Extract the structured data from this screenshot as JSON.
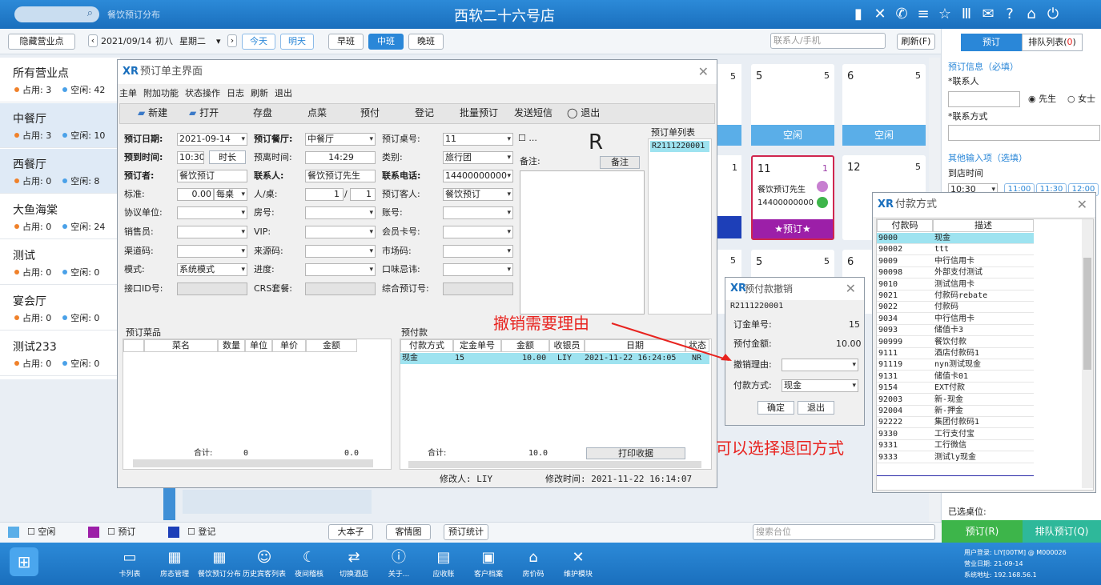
{
  "top": {
    "search_sub": "餐饮预订分布",
    "store": "西软二十六号店"
  },
  "toolbar": {
    "hide": "隐藏营业点",
    "date": "2021/09/14",
    "lunar": "初八",
    "weekday": "星期二",
    "today": "今天",
    "tomorrow": "明天",
    "shift_morning": "早班",
    "shift_mid": "中班",
    "shift_night": "晚班",
    "search_ph": "联系人/手机",
    "refresh": "刷新(F)"
  },
  "outlets": [
    {
      "name": "所有营业点",
      "used": "占用: 3",
      "free": "空闲: 42"
    },
    {
      "name": "中餐厅",
      "used": "占用: 3",
      "free": "空闲: 10"
    },
    {
      "name": "西餐厅",
      "used": "占用: 0",
      "free": "空闲: 8"
    },
    {
      "name": "大鱼海棠",
      "used": "占用: 0",
      "free": "空闲: 24"
    },
    {
      "name": "测试",
      "used": "占用: 0",
      "free": "空闲: 0"
    },
    {
      "name": "宴会厅",
      "used": "占用: 0",
      "free": "空闲: 0"
    },
    {
      "name": "测试233",
      "used": "占用: 0",
      "free": "空闲: 0"
    }
  ],
  "tables": {
    "t5": "5",
    "t5c": "5",
    "t6": "6",
    "t6c": "5",
    "free": "空闲",
    "t11": "11",
    "t11c": "1",
    "guest": "餐饮预订先生",
    "phone": "14400000000",
    "booked": "★预订★",
    "t12": "12",
    "t12c": "5",
    "left1": "5",
    "left2": "1",
    "left3": "5",
    "b5": "5",
    "b5c": "5",
    "b6": "6"
  },
  "right": {
    "tab_book": "预订",
    "tab_queue": "排队列表(",
    "queue_n": "0",
    "queue_end": ")",
    "info": "预订信息（必填）",
    "contact": "*联系人",
    "mr": "先生",
    "ms": "女士",
    "method": "*联系方式",
    "other": "其他输入项（选填）",
    "arrive": "到店时间",
    "arrive_val": "10:30",
    "s1": "11:00",
    "s2": "11:30",
    "s3": "12:00",
    "chosen": "已选桌位:",
    "book_btn": "预订(R)",
    "queue_btn": "排队预订(Q)"
  },
  "legend": {
    "free": "空闲",
    "book": "预订",
    "reg": "登记",
    "b1": "大本子",
    "b2": "客情图",
    "b3": "预订统计",
    "search_ph": "搜索台位"
  },
  "dock": [
    "卡列表",
    "房态管理",
    "餐饮预订分布",
    "历史宾客列表",
    "夜间稽核",
    "切换酒店",
    "关于...",
    "应收账",
    "客户档案",
    "房价码",
    "维护模块"
  ],
  "status": {
    "user": "用户登录: LIY[00TM] @ M000026",
    "date": "营业日期:  21-09-14",
    "ip": "系统地址:  192.168.56.1"
  },
  "main": {
    "title": "预订单主界面",
    "menu": [
      "主单",
      "附加功能",
      "状态操作",
      "日志",
      "刷新",
      "退出"
    ],
    "tbar": [
      "新建",
      "打开",
      "存盘",
      "点菜",
      "预付",
      "登记",
      "批量预订",
      "发送短信",
      "退出"
    ],
    "r": "R",
    "list_title": "预订单列表",
    "list_item": "R2111220001",
    "remark_l": "备注:",
    "remark_b": "备注",
    "f": {
      "date_l": "预订日期:",
      "date": "2021-09-14",
      "rest_l": "预订餐厅:",
      "rest": "中餐厅",
      "tno_l": "预订桌号:",
      "tno": "11",
      "time_l": "预到时间:",
      "time": "10:30",
      "dur": "时长",
      "leave_l": "预离时间:",
      "leave": "14:29",
      "type_l": "类别:",
      "type": "旅行团",
      "booker_l": "预订者:",
      "booker": "餐饮预订",
      "contact_l": "联系人:",
      "contact": "餐饮预订先生",
      "phone_l": "联系电话:",
      "phone": "14400000000",
      "std_l": "标准:",
      "std": "0.00",
      "per": "每桌",
      "ppl_l": "人/桌:",
      "ppl": "1",
      "ppl2": "1",
      "guest_l": "预订客人:",
      "guest": "餐饮预订",
      "unit_l": "协议单位:",
      "room_l": "房号:",
      "acct_l": "账号:",
      "sales_l": "销售员:",
      "vip_l": "VIP:",
      "card_l": "会员卡号:",
      "chan_l": "渠道码:",
      "src_l": "来源码:",
      "mkt_l": "市场码:",
      "mode_l": "模式:",
      "mode": "系统模式",
      "prog_l": "进度:",
      "taste_l": "口味忌讳:",
      "api_l": "接口ID号:",
      "crs_l": "CRS套餐:",
      "comp_l": "综合预订号:"
    },
    "dish": {
      "title": "预订菜品",
      "cols": [
        "菜名",
        "数量",
        "单位",
        "单价",
        "金额"
      ],
      "sum": "合计:",
      "n": "0",
      "amt": "0.0"
    },
    "pay": {
      "title": "预付款",
      "cols": [
        "付款方式",
        "定金单号",
        "金额",
        "收银员",
        "日期",
        "状态"
      ],
      "row": [
        "现金",
        "15",
        "10.00",
        "LIY",
        "2021-11-22 16:24:05",
        "NR"
      ],
      "sum": "合计:",
      "amt": "10.0",
      "print": "打印收据"
    },
    "mod": "修改人: LIY",
    "modt": "修改时间: 2021-11-22 16:14:07"
  },
  "cancel": {
    "title": "预付款撤销",
    "no": "R2111220001",
    "dep_l": "订金单号:",
    "dep": "15",
    "amt_l": "预付金额:",
    "amt": "10.00",
    "reason_l": "撤销理由:",
    "method_l": "付款方式:",
    "method": "现金",
    "ok": "确定",
    "exit": "退出"
  },
  "paym": {
    "title": "付款方式",
    "cols": [
      "付款码",
      "描述"
    ],
    "rows": [
      [
        "9000",
        "现金"
      ],
      [
        "90002",
        "ttt"
      ],
      [
        "9009",
        "中行信用卡"
      ],
      [
        "90098",
        "外部支付测试"
      ],
      [
        "9010",
        "测试信用卡"
      ],
      [
        "9021",
        "付款码rebate"
      ],
      [
        "9022",
        "付款码"
      ],
      [
        "9034",
        "中行信用卡"
      ],
      [
        "9093",
        "储值卡3"
      ],
      [
        "90999",
        "餐饮付款"
      ],
      [
        "9111",
        "酒店付款码1"
      ],
      [
        "91119",
        "nyn测试现金"
      ],
      [
        "9131",
        "储值卡01"
      ],
      [
        "9154",
        "EXT付款"
      ],
      [
        "92003",
        "新-现金"
      ],
      [
        "92004",
        "新-押金"
      ],
      [
        "92222",
        "集团付款码1"
      ],
      [
        "9330",
        "工行支付宝"
      ],
      [
        "9331",
        "工行微信"
      ],
      [
        "9333",
        "测试ly现金"
      ]
    ]
  },
  "notes": {
    "a": "撤销需要理由",
    "b": "可以选择退回方式"
  }
}
